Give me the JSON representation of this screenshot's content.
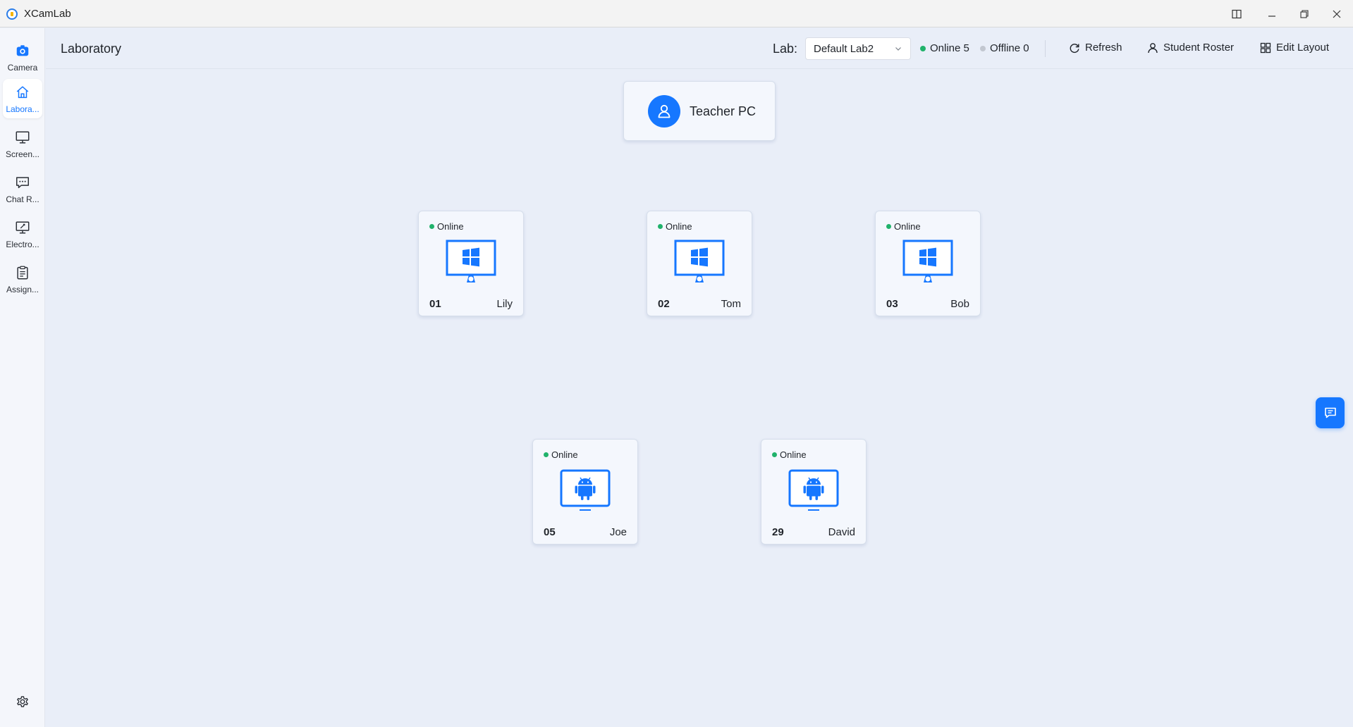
{
  "app": {
    "title": "XCamLab"
  },
  "sidebar": {
    "items": [
      {
        "label": "Camera",
        "icon": "camera-icon",
        "active": false
      },
      {
        "label": "Labora...",
        "icon": "home-icon",
        "active": true
      },
      {
        "label": "Screen...",
        "icon": "monitor-icon",
        "active": false
      },
      {
        "label": "Chat R...",
        "icon": "chat-icon",
        "active": false
      },
      {
        "label": "Electro...",
        "icon": "whiteboard-icon",
        "active": false
      },
      {
        "label": "Assign...",
        "icon": "clipboard-icon",
        "active": false
      }
    ],
    "settings_icon": "gear-icon"
  },
  "header": {
    "title": "Laboratory",
    "lab_label": "Lab:",
    "lab_value": "Default Lab2",
    "online_text": "Online 5",
    "offline_text": "Offline 0",
    "refresh_label": "Refresh",
    "roster_label": "Student Roster",
    "edit_layout_label": "Edit Layout"
  },
  "teacher": {
    "name": "Teacher PC"
  },
  "students": [
    {
      "status": "Online",
      "number": "01",
      "name": "Lily",
      "os": "windows"
    },
    {
      "status": "Online",
      "number": "02",
      "name": "Tom",
      "os": "windows"
    },
    {
      "status": "Online",
      "number": "03",
      "name": "Bob",
      "os": "windows"
    },
    {
      "status": "Online",
      "number": "05",
      "name": "Joe",
      "os": "android"
    },
    {
      "status": "Online",
      "number": "29",
      "name": "David",
      "os": "android"
    }
  ],
  "colors": {
    "accent": "#1677ff",
    "online": "#20b26b",
    "offline": "#c2c7d0"
  }
}
